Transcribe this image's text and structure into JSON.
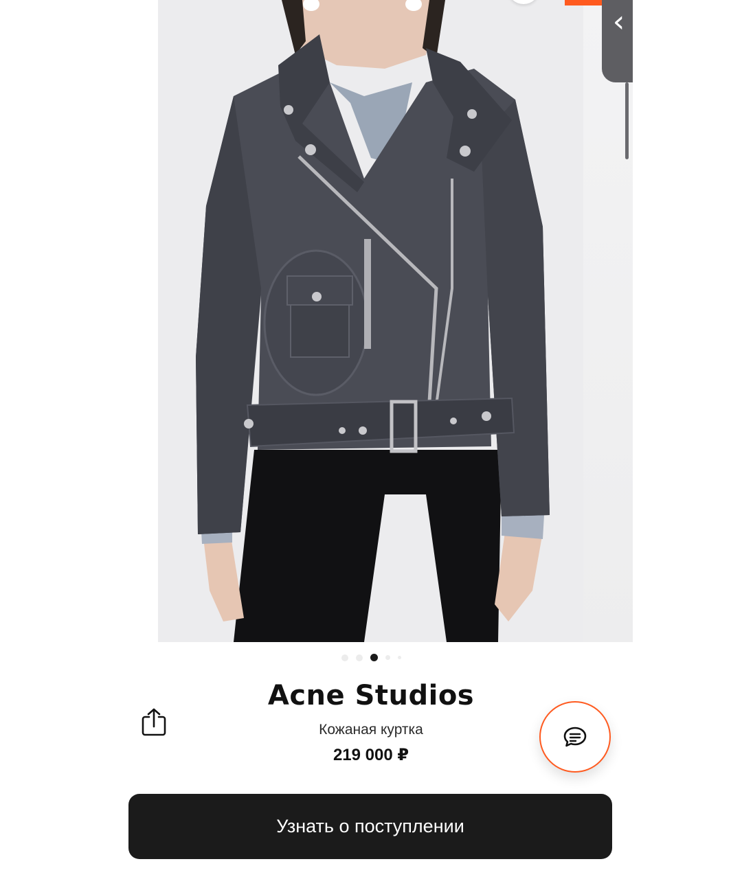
{
  "product": {
    "brand": "Acne Studios",
    "name": "Кожаная куртка",
    "price": "219 000 ₽"
  },
  "gallery": {
    "total_images": 5,
    "active_index": 2
  },
  "actions": {
    "notify_label": "Узнать о поступлении"
  },
  "icons": {
    "back": "chevron-left-icon",
    "share": "share-icon",
    "chat": "chat-icon"
  },
  "colors": {
    "accent": "#ff5a1f",
    "cta_background": "#1b1b1b",
    "cta_text": "#ffffff",
    "active_dot": "#1a1a1a",
    "inactive_dot": "#ececec"
  }
}
